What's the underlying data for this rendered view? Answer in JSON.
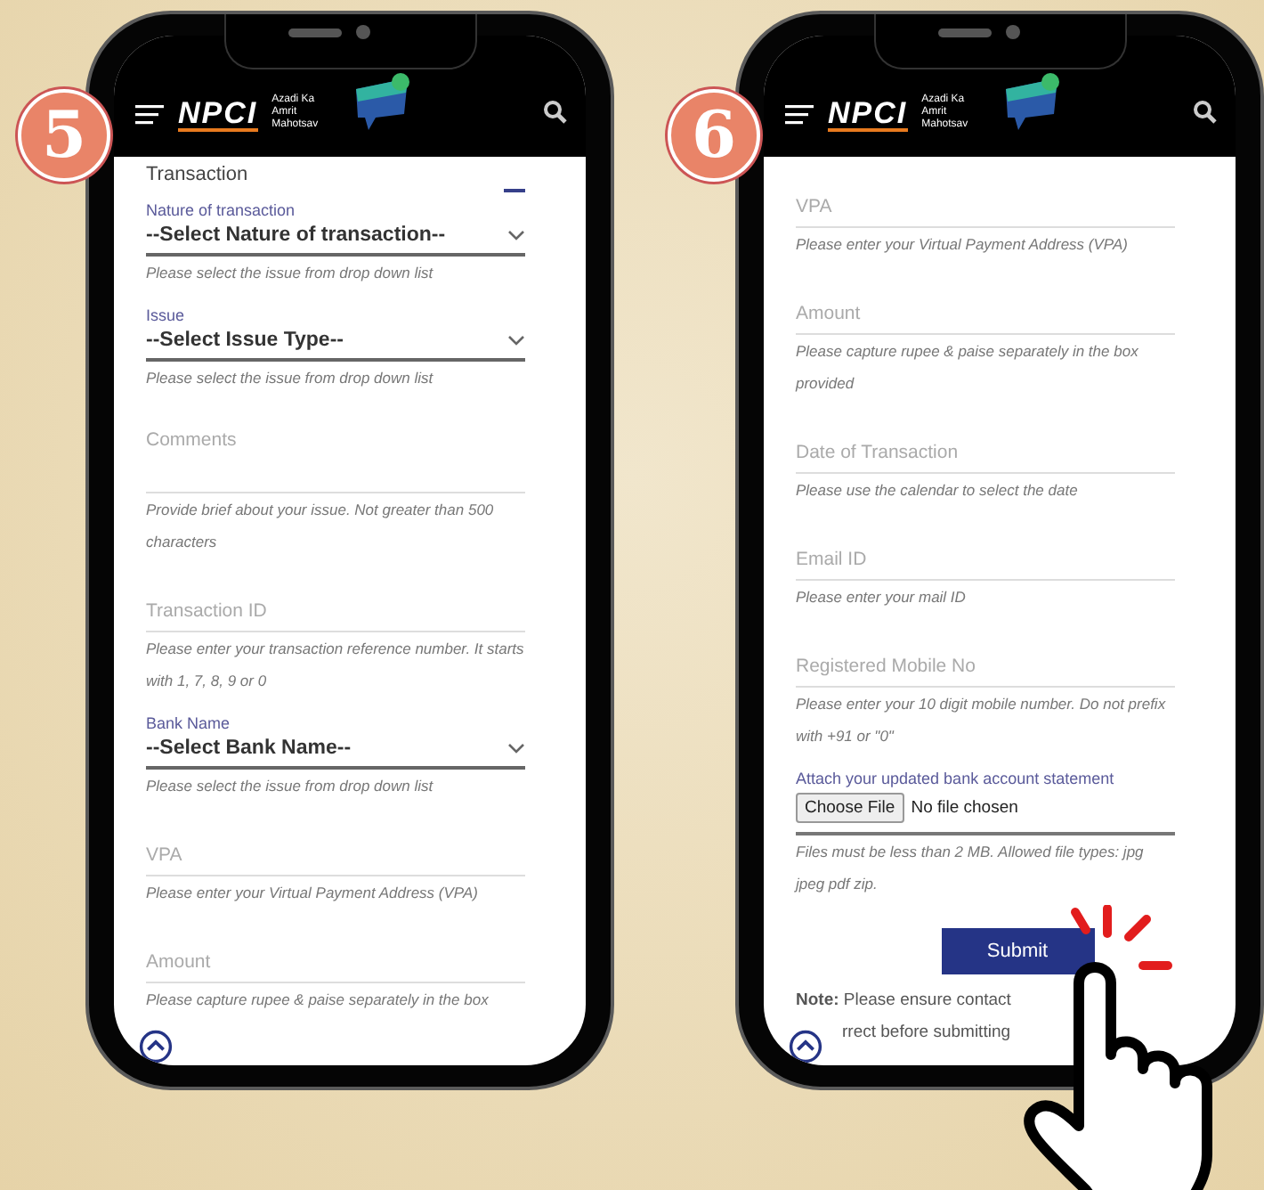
{
  "phones": [
    {
      "step": "5",
      "header": {
        "brand": "NPCI",
        "tagline": "Azadi Ka Amrit Mahotsav"
      },
      "fields": [
        {
          "kind": "section",
          "title": "Transaction",
          "expanded": true
        },
        {
          "kind": "select",
          "label": "Nature of transaction",
          "value": "--Select Nature of transaction--",
          "hint": "Please select the issue from drop down list"
        },
        {
          "kind": "select",
          "label": "Issue",
          "value": "--Select Issue Type--",
          "hint": "Please select the issue from drop down list"
        },
        {
          "kind": "textarea",
          "placeholder": "Comments",
          "hint": "Provide brief about your issue. Not greater than 500 characters"
        },
        {
          "kind": "input",
          "placeholder": "Transaction ID",
          "hint": "Please enter your transaction reference number. It starts with 1, 7, 8, 9 or 0"
        },
        {
          "kind": "select",
          "label": "Bank Name",
          "value": "--Select Bank Name--",
          "hint": "Please select the issue from drop down list"
        },
        {
          "kind": "input",
          "placeholder": "VPA",
          "hint": "Please enter your Virtual Payment Address (VPA)"
        },
        {
          "kind": "input",
          "placeholder": "Amount",
          "hint": "Please capture rupee & paise separately in the box"
        }
      ]
    },
    {
      "step": "6",
      "header": {
        "brand": "NPCI",
        "tagline": "Azadi Ka Amrit Mahotsav"
      },
      "fields": [
        {
          "kind": "input",
          "placeholder": "VPA",
          "hint": "Please enter your Virtual Payment Address (VPA)"
        },
        {
          "kind": "input",
          "placeholder": "Amount",
          "hint": "Please capture rupee & paise separately in the box provided"
        },
        {
          "kind": "input",
          "placeholder": "Date of Transaction",
          "hint": "Please use the calendar to select the date"
        },
        {
          "kind": "input",
          "placeholder": "Email ID",
          "hint": "Please enter your mail ID"
        },
        {
          "kind": "input",
          "placeholder": "Registered Mobile No",
          "hint": "Please enter your 10 digit mobile number. Do not prefix with +91 or \"0\""
        },
        {
          "kind": "file",
          "label": "Attach your updated bank account statement",
          "button": "Choose File",
          "status": "No file chosen",
          "hint": "Files must be less than 2 MB. Allowed file types: jpg jpeg pdf zip."
        },
        {
          "kind": "submit",
          "label": "Submit"
        },
        {
          "kind": "note",
          "text": "**Note:** Please ensure contact",
          "continuation": "rrect before submitting"
        }
      ]
    }
  ]
}
